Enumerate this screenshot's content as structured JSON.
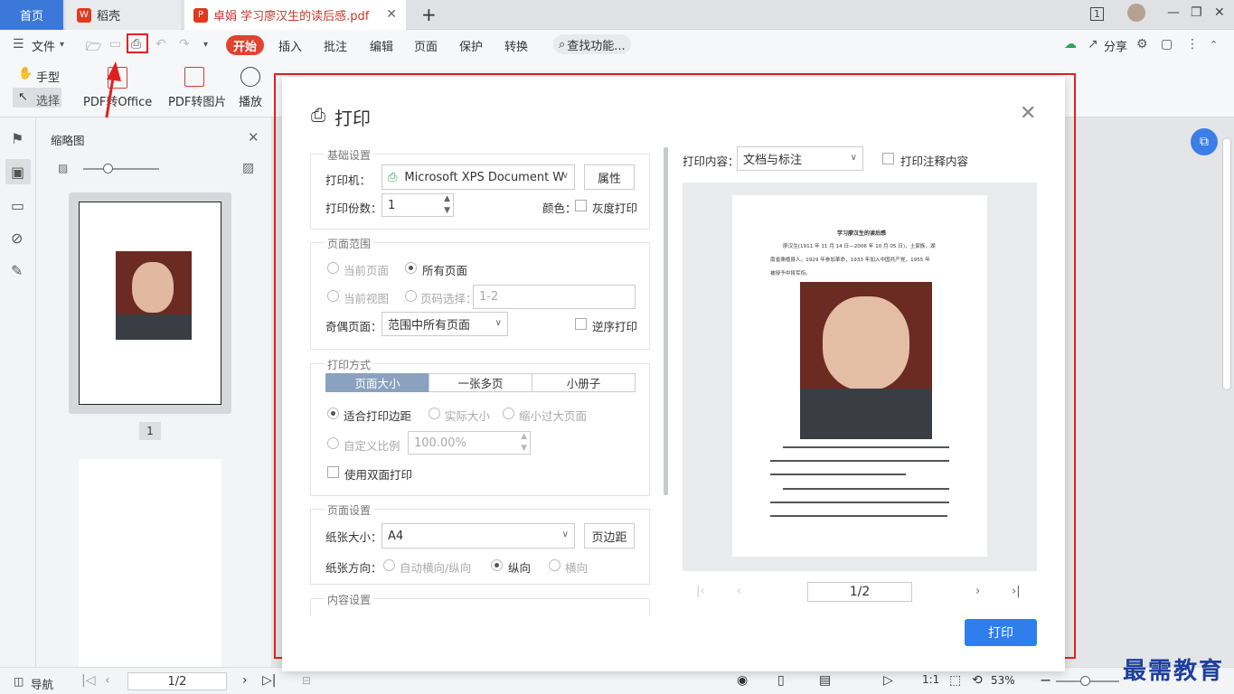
{
  "tabs": {
    "home": "首页",
    "daoke": "稻壳",
    "doc": "卓娟 学习廖汉生的读后感.pdf"
  },
  "menu": {
    "file": "文件",
    "start": "开始",
    "insert": "插入",
    "annotate": "批注",
    "edit": "编辑",
    "page": "页面",
    "protect": "保护",
    "convert": "转换",
    "search": "查找功能...",
    "share": "分享"
  },
  "toolbar": {
    "hand": "手型",
    "select": "选择",
    "pdf_office": "PDF转Office",
    "pdf_image": "PDF转图片",
    "play": "播放"
  },
  "thumbs": {
    "title": "缩略图",
    "page1_label": "1"
  },
  "dialog": {
    "title": "打印",
    "basic": {
      "group": "基础设置",
      "printer_label": "打印机：",
      "printer_value": "Microsoft XPS Document W",
      "props": "属性",
      "copies_label": "打印份数：",
      "copies_value": "1",
      "color_label": "颜色：",
      "grayscale": "灰度打印"
    },
    "range": {
      "group": "页面范围",
      "current_page": "当前页面",
      "all_pages": "所有页面",
      "current_view": "当前视图",
      "page_select": "页码选择：",
      "page_select_placeholder": "1-2",
      "odd_even_label": "奇偶页面：",
      "odd_even_value": "范围中所有页面",
      "reverse": "逆序打印"
    },
    "mode": {
      "group": "打印方式",
      "seg1": "页面大小",
      "seg2": "一张多页",
      "seg3": "小册子",
      "fit_margin": "适合打印边距",
      "actual": "实际大小",
      "shrink": "缩小过大页面",
      "custom": "自定义比例",
      "custom_value": "100.00%",
      "duplex": "使用双面打印"
    },
    "pagesetup": {
      "group": "页面设置",
      "paper_label": "纸张大小：",
      "paper_value": "A4",
      "margins": "页边距",
      "orient_label": "纸张方向：",
      "auto": "自动横向/纵向",
      "portrait": "纵向",
      "landscape": "横向"
    },
    "content": {
      "group": "内容设置"
    },
    "preview": {
      "content_label": "打印内容：",
      "content_value": "文档与标注",
      "print_annot": "打印注释内容",
      "page_indicator": "1/2",
      "doc_title": "学习廖汉生的读后感",
      "line1": "廖汉生(1911 年 11 月 14 日—2006 年 10 月 05 日)，土家族，湖",
      "line2": "南省桑植县人。1929 年参加革命，1933 年加入中国共产党，1955 年",
      "line3": "被授予中将军衔。"
    },
    "print_button": "打印"
  },
  "status": {
    "nav": "导航",
    "page": "1/2",
    "zoom": "53%"
  },
  "watermark": "最需教育"
}
